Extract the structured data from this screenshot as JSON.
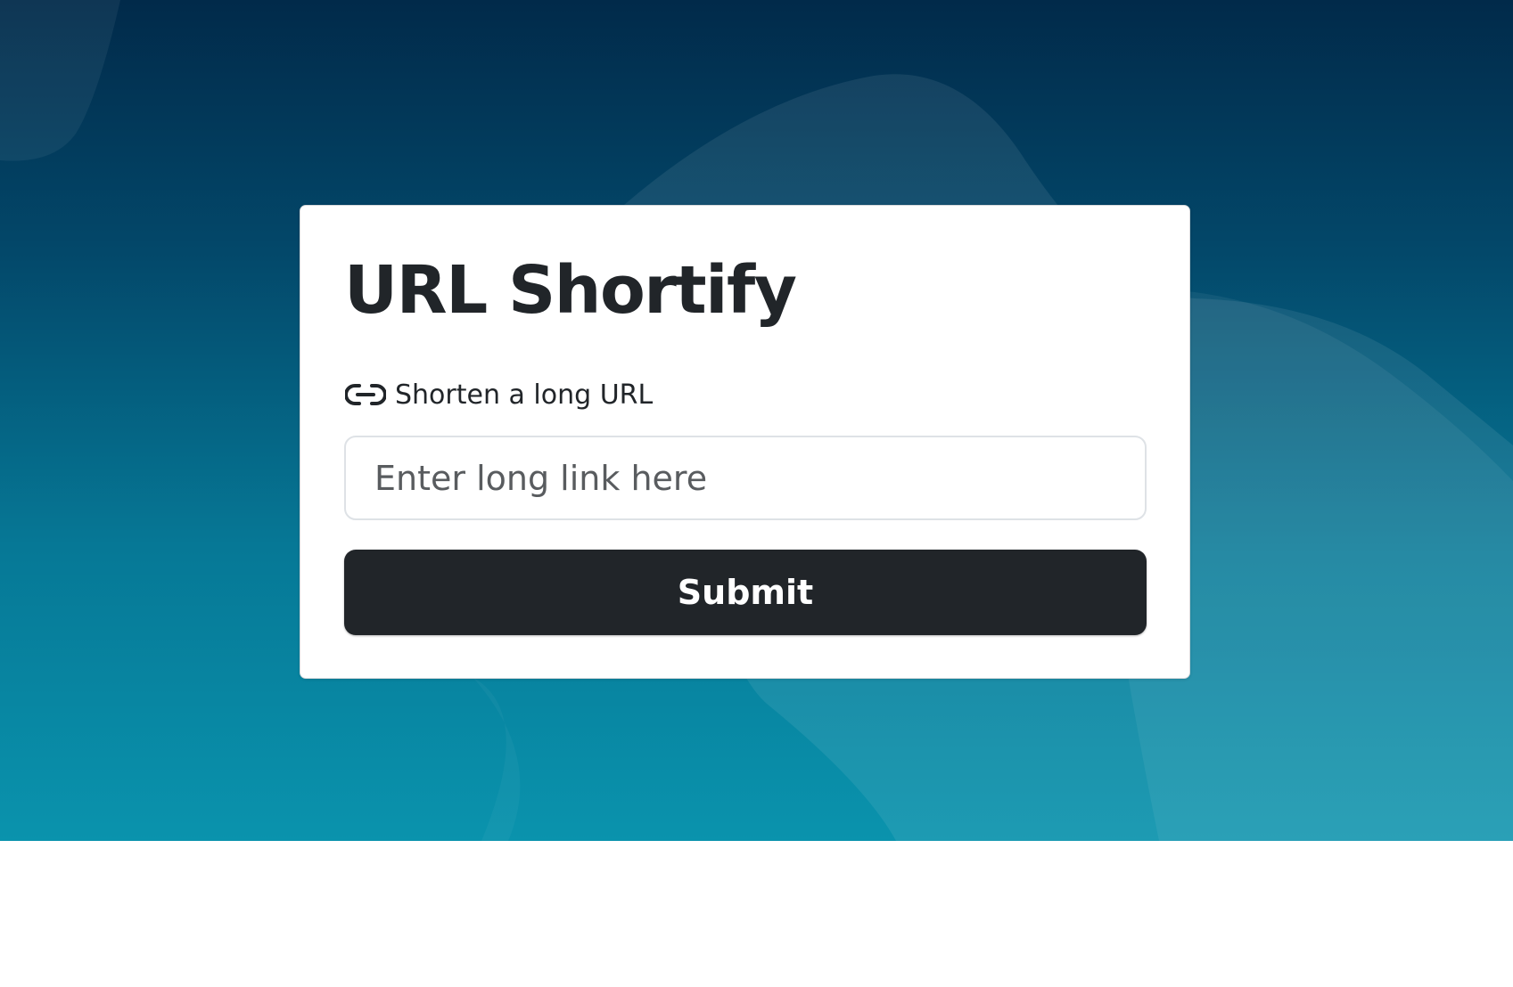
{
  "app": {
    "title": "URL Shortify"
  },
  "form": {
    "label": "Shorten a long URL",
    "label_icon": "link-icon",
    "input_placeholder": "Enter long link here",
    "input_value": "",
    "submit_label": "Submit"
  },
  "colors": {
    "background_top": "#012a4a",
    "background_bottom": "#0a93ad",
    "card": "#ffffff",
    "text": "#212529",
    "button": "#212529",
    "button_text": "#ffffff"
  }
}
